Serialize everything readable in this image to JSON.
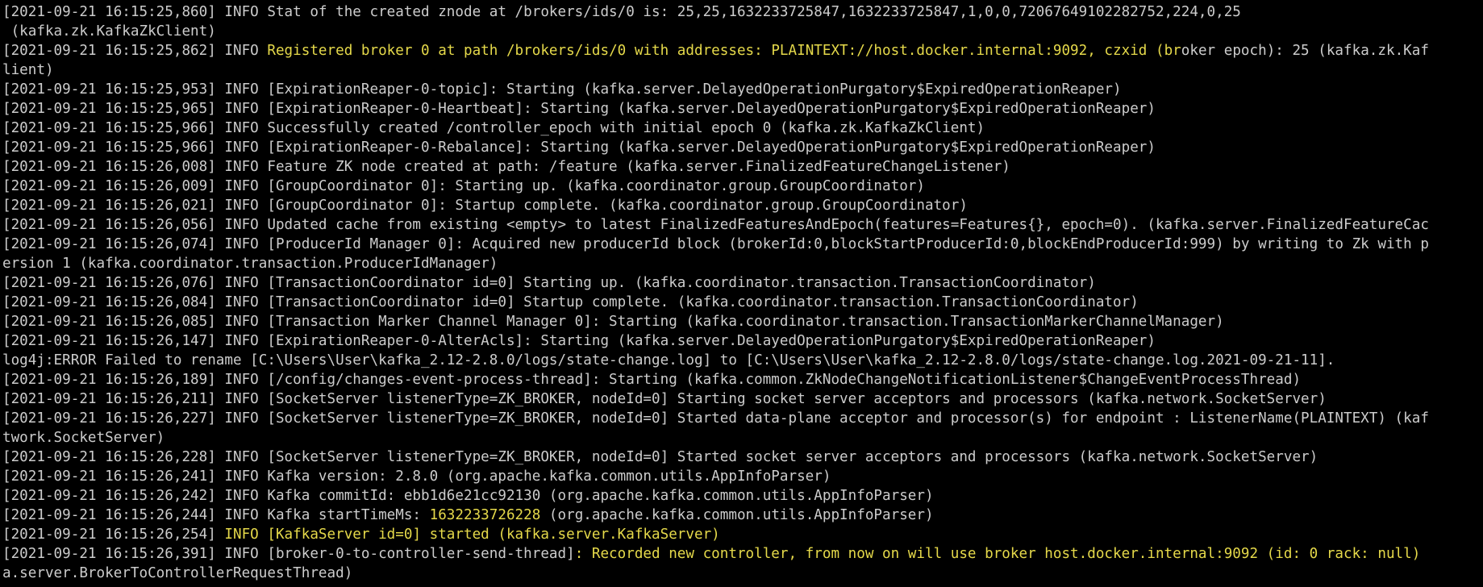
{
  "theme": {
    "background": "#000000",
    "foreground": "#cccccc",
    "highlight": "#e5d94a"
  },
  "terminal": {
    "lines": [
      {
        "parts": [
          {
            "t": "[2021-09-21 16:15:25,860] INFO Stat of the created znode at /brokers/ids/0 is: 25,25,1632233725847,1632233725847,1,0,0,72067649102282752,224,0,25",
            "c": ""
          }
        ]
      },
      {
        "parts": [
          {
            "t": " (kafka.zk.KafkaZkClient)",
            "c": ""
          }
        ]
      },
      {
        "parts": [
          {
            "t": "[2021-09-21 16:15:25,862] INFO ",
            "c": ""
          },
          {
            "t": "Registered broker 0 at path /brokers/ids/0 with addresses: PLAINTEXT://host.docker.internal:9092, czxid (br",
            "c": "hl"
          },
          {
            "t": "oker epoch): 25 (kafka.zk.Kaf",
            "c": ""
          }
        ]
      },
      {
        "parts": [
          {
            "t": "lient)",
            "c": ""
          }
        ]
      },
      {
        "parts": [
          {
            "t": "[2021-09-21 16:15:25,953] INFO [ExpirationReaper-0-topic]: Starting (kafka.server.DelayedOperationPurgatory$ExpiredOperationReaper)",
            "c": ""
          }
        ]
      },
      {
        "parts": [
          {
            "t": "[2021-09-21 16:15:25,965] INFO [ExpirationReaper-0-Heartbeat]: Starting (kafka.server.DelayedOperationPurgatory$ExpiredOperationReaper)",
            "c": ""
          }
        ]
      },
      {
        "parts": [
          {
            "t": "[2021-09-21 16:15:25,966] INFO Successfully created /controller_epoch with initial epoch 0 (kafka.zk.KafkaZkClient)",
            "c": ""
          }
        ]
      },
      {
        "parts": [
          {
            "t": "[2021-09-21 16:15:25,966] INFO [ExpirationReaper-0-Rebalance]: Starting (kafka.server.DelayedOperationPurgatory$ExpiredOperationReaper)",
            "c": ""
          }
        ]
      },
      {
        "parts": [
          {
            "t": "[2021-09-21 16:15:26,008] INFO Feature ZK node created at path: /feature (kafka.server.FinalizedFeatureChangeListener)",
            "c": ""
          }
        ]
      },
      {
        "parts": [
          {
            "t": "[2021-09-21 16:15:26,009] INFO [GroupCoordinator 0]: Starting up. (kafka.coordinator.group.GroupCoordinator)",
            "c": ""
          }
        ]
      },
      {
        "parts": [
          {
            "t": "[2021-09-21 16:15:26,021] INFO [GroupCoordinator 0]: Startup complete. (kafka.coordinator.group.GroupCoordinator)",
            "c": ""
          }
        ]
      },
      {
        "parts": [
          {
            "t": "[2021-09-21 16:15:26,056] INFO Updated cache from existing <empty> to latest FinalizedFeaturesAndEpoch(features=Features{}, epoch=0). (kafka.server.FinalizedFeatureCac",
            "c": ""
          }
        ]
      },
      {
        "parts": [
          {
            "t": "[2021-09-21 16:15:26,074] INFO [ProducerId Manager 0]: Acquired new producerId block (brokerId:0,blockStartProducerId:0,blockEndProducerId:999) by writing to Zk with p",
            "c": ""
          }
        ]
      },
      {
        "parts": [
          {
            "t": "ersion 1 (kafka.coordinator.transaction.ProducerIdManager)",
            "c": ""
          }
        ]
      },
      {
        "parts": [
          {
            "t": "[2021-09-21 16:15:26,076] INFO [TransactionCoordinator id=0] Starting up. (kafka.coordinator.transaction.TransactionCoordinator)",
            "c": ""
          }
        ]
      },
      {
        "parts": [
          {
            "t": "[2021-09-21 16:15:26,084] INFO [TransactionCoordinator id=0] Startup complete. (kafka.coordinator.transaction.TransactionCoordinator)",
            "c": ""
          }
        ]
      },
      {
        "parts": [
          {
            "t": "[2021-09-21 16:15:26,085] INFO [Transaction Marker Channel Manager 0]: Starting (kafka.coordinator.transaction.TransactionMarkerChannelManager)",
            "c": ""
          }
        ]
      },
      {
        "parts": [
          {
            "t": "[2021-09-21 16:15:26,147] INFO [ExpirationReaper-0-AlterAcls]: Starting (kafka.server.DelayedOperationPurgatory$ExpiredOperationReaper)",
            "c": ""
          }
        ]
      },
      {
        "parts": [
          {
            "t": "log4j:ERROR Failed to rename [C:\\Users\\User\\kafka_2.12-2.8.0/logs/state-change.log] to [C:\\Users\\User\\kafka_2.12-2.8.0/logs/state-change.log.2021-09-21-11].",
            "c": ""
          }
        ]
      },
      {
        "parts": [
          {
            "t": "[2021-09-21 16:15:26,189] INFO [/config/changes-event-process-thread]: Starting (kafka.common.ZkNodeChangeNotificationListener$ChangeEventProcessThread)",
            "c": ""
          }
        ]
      },
      {
        "parts": [
          {
            "t": "[2021-09-21 16:15:26,211] INFO [SocketServer listenerType=ZK_BROKER, nodeId=0] Starting socket server acceptors and processors (kafka.network.SocketServer)",
            "c": ""
          }
        ]
      },
      {
        "parts": [
          {
            "t": "[2021-09-21 16:15:26,227] INFO [SocketServer listenerType=ZK_BROKER, nodeId=0] Started data-plane acceptor and processor(s) for endpoint : ListenerName(PLAINTEXT) (kaf",
            "c": ""
          }
        ]
      },
      {
        "parts": [
          {
            "t": "twork.SocketServer)",
            "c": ""
          }
        ]
      },
      {
        "parts": [
          {
            "t": "[2021-09-21 16:15:26,228] INFO [SocketServer listenerType=ZK_BROKER, nodeId=0] Started socket server acceptors and processors (kafka.network.SocketServer)",
            "c": ""
          }
        ]
      },
      {
        "parts": [
          {
            "t": "[2021-09-21 16:15:26,241] INFO Kafka version: 2.8.0 (org.apache.kafka.common.utils.AppInfoParser)",
            "c": ""
          }
        ]
      },
      {
        "parts": [
          {
            "t": "[2021-09-21 16:15:26,242] INFO Kafka commitId: ebb1d6e21cc92130 (org.apache.kafka.common.utils.AppInfoParser)",
            "c": ""
          }
        ]
      },
      {
        "parts": [
          {
            "t": "[2021-09-21 16:15:26,244] INFO Kafka startTimeMs: ",
            "c": ""
          },
          {
            "t": "1632233726228",
            "c": "hl"
          },
          {
            "t": " (org.apache.kafka.common.utils.AppInfoParser)",
            "c": ""
          }
        ]
      },
      {
        "parts": [
          {
            "t": "[2021-09-21 16:15:26,254] ",
            "c": ""
          },
          {
            "t": "INFO [KafkaServer id=0] started (kafka.server.KafkaServer)",
            "c": "hl"
          }
        ]
      },
      {
        "parts": [
          {
            "t": "[2021-09-21 16:15:26,391] INFO [broker-0-to-controller-send-thread]",
            "c": ""
          },
          {
            "t": ": Recorded new controller, from now on will use broker host.docker.internal:9092 (id: 0 rack: null)",
            "c": "hl"
          }
        ]
      },
      {
        "parts": [
          {
            "t": "a.server.BrokerToControllerRequestThread)",
            "c": ""
          }
        ]
      }
    ]
  }
}
